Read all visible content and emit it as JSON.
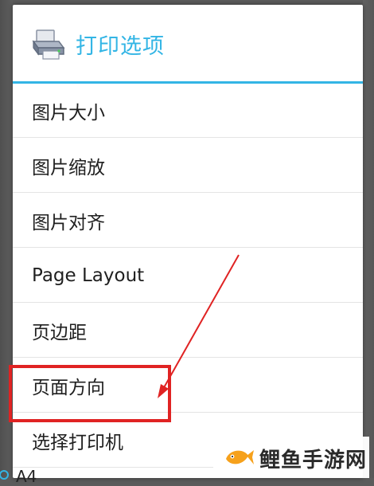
{
  "dialog": {
    "title": "打印选项",
    "icon": "printer-icon",
    "accent_color": "#33b5e5"
  },
  "menu": {
    "items": [
      {
        "label": "图片大小"
      },
      {
        "label": "图片缩放"
      },
      {
        "label": "图片对齐"
      },
      {
        "label": "Page Layout"
      },
      {
        "label": "页边距"
      },
      {
        "label": "页面方向"
      },
      {
        "label": "选择打印机"
      }
    ]
  },
  "background": {
    "partial_text": "A4"
  },
  "annotation": {
    "highlight_color": "#e02323",
    "highlighted_item": "页面方向"
  },
  "watermark": {
    "text": "鲤鱼手游网",
    "logo_icon": "fish-logo-icon"
  }
}
